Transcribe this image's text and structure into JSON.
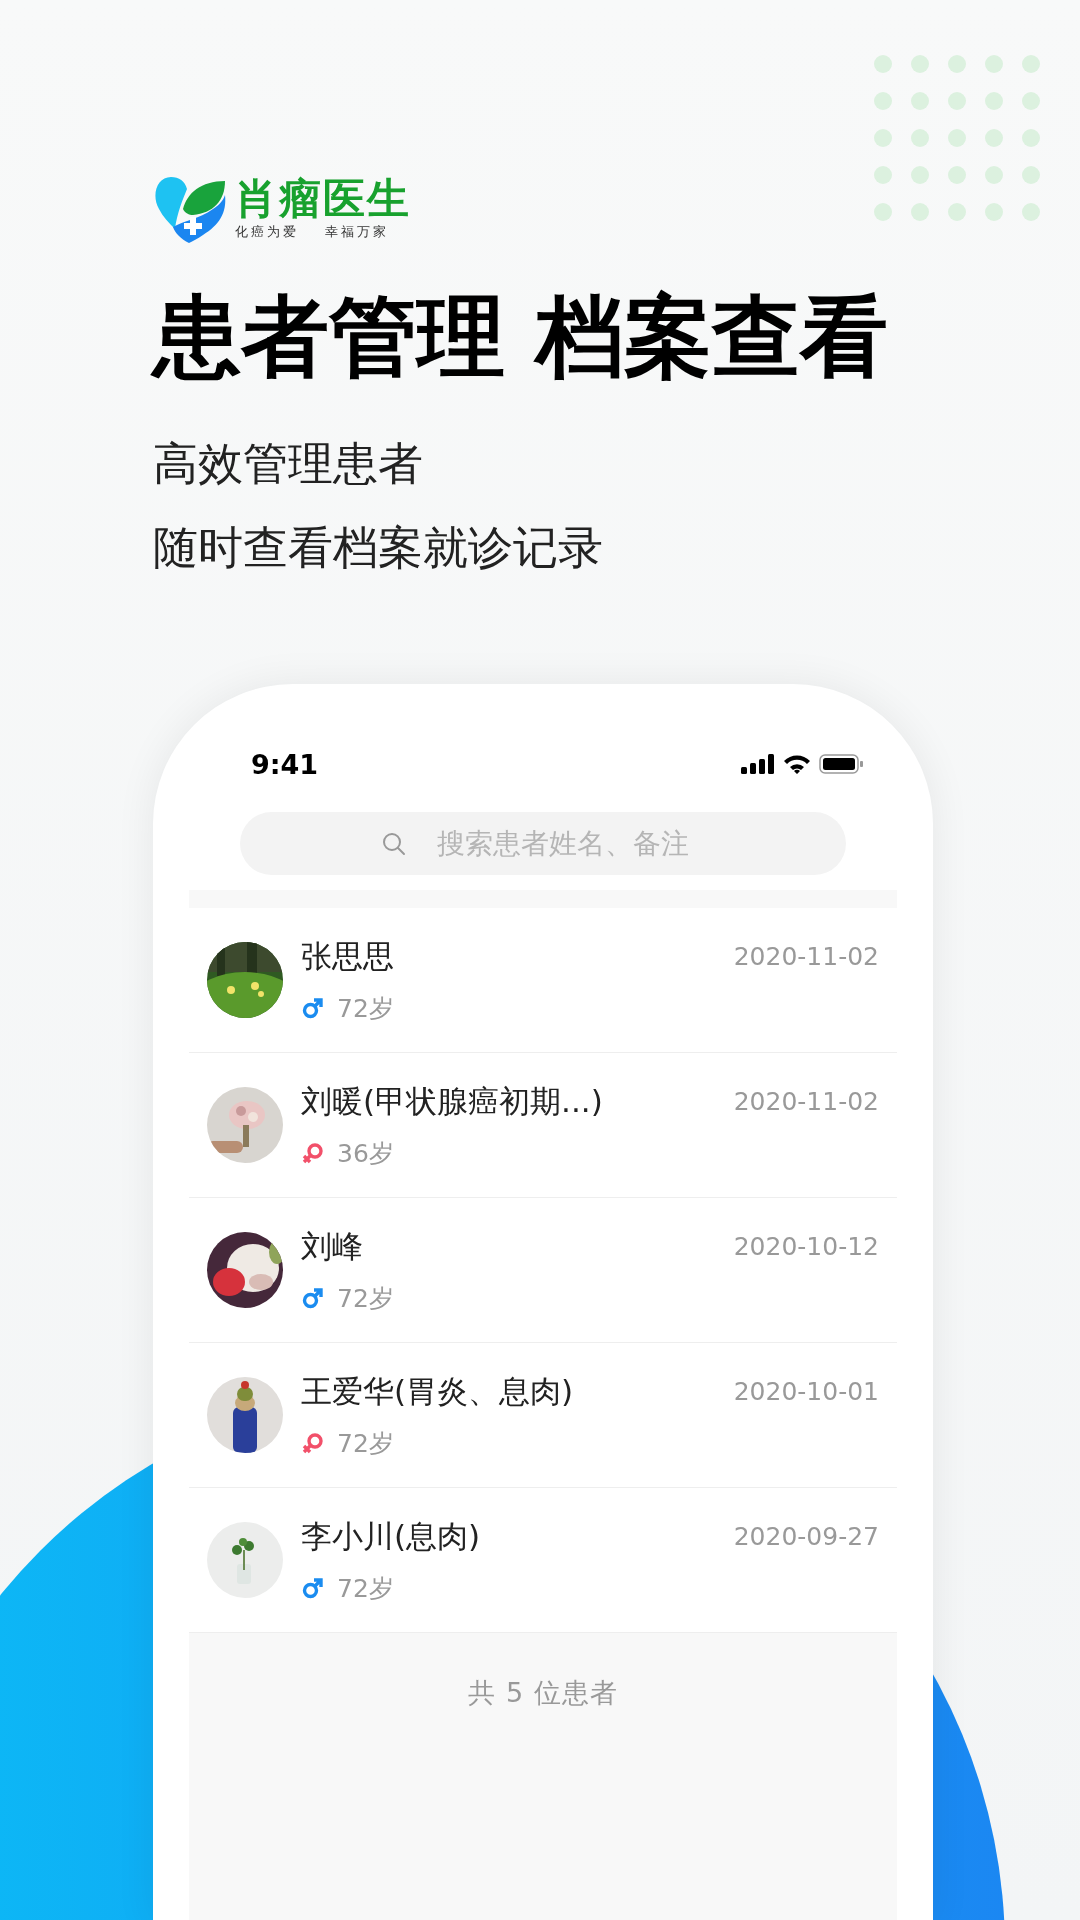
{
  "logo": {
    "name": "肖瘤医生",
    "slogans": [
      "化癌为爱",
      "幸福万家"
    ]
  },
  "headline": "患者管理 档案查看",
  "subtitles": [
    "高效管理患者",
    "随时查看档案就诊记录"
  ],
  "phone": {
    "status_bar": {
      "time": "9:41"
    },
    "search": {
      "placeholder": "搜索患者姓名、备注"
    },
    "patients": [
      {
        "name": "张思思",
        "kind": "male",
        "age": "72岁",
        "date": "2020-11-02"
      },
      {
        "name": "刘暖(甲状腺癌初期...)",
        "kind": "female",
        "age": "36岁",
        "date": "2020-11-02"
      },
      {
        "name": "刘峰",
        "kind": "male",
        "age": "72岁",
        "date": "2020-10-12"
      },
      {
        "name": "王爱华(胃炎、息肉)",
        "kind": "female",
        "age": "72岁",
        "date": "2020-10-01"
      },
      {
        "name": "李小川(息肉)",
        "kind": "male",
        "age": "72岁",
        "date": "2020-09-27"
      }
    ],
    "footer": "共 5 位患者"
  }
}
